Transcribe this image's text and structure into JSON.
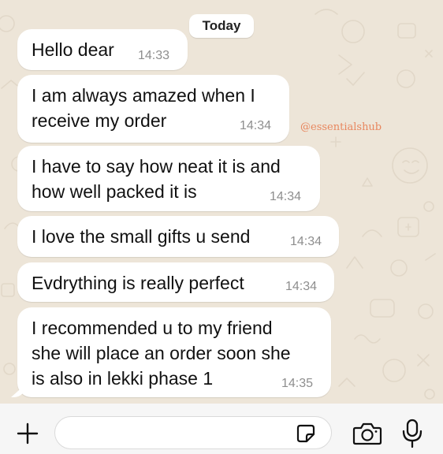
{
  "day_divider": "Today",
  "messages": [
    {
      "text": "Hello dear",
      "time": "14:33"
    },
    {
      "text": "I am always amazed when I\nreceive my order",
      "time": "14:34"
    },
    {
      "text": "I have to say how neat it is and\nhow well packed it is",
      "time": "14:34"
    },
    {
      "text": "I love the small gifts u send",
      "time": "14:34"
    },
    {
      "text": "Evdrything is really perfect",
      "time": "14:34"
    },
    {
      "text": "I recommended u to my friend\nshe will place an order soon she\nis also in lekki phase 1",
      "time": "14:35"
    }
  ],
  "watermark": "@essentialshub",
  "composer": {
    "input_value": "",
    "icons": [
      "plus-icon",
      "sticker-icon",
      "camera-icon",
      "microphone-icon"
    ],
    "accent_color": "#111111"
  },
  "colors": {
    "bubble": "#ffffff",
    "background": "#ede5d8",
    "watermark": "#e8875f",
    "timestamp": "#8e8e8e"
  }
}
